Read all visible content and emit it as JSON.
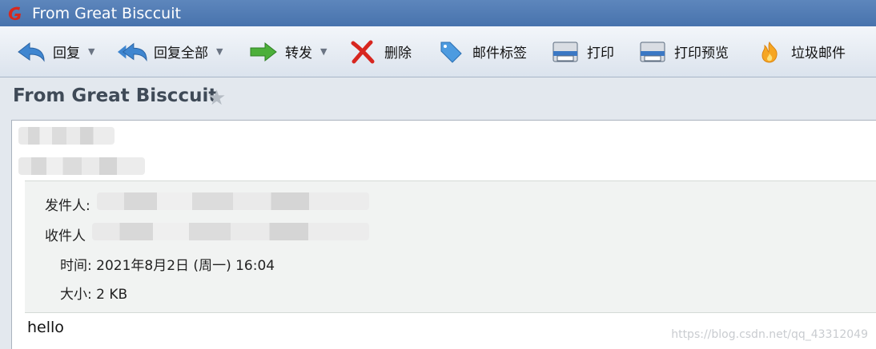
{
  "window": {
    "title": "From Great Bisccuit"
  },
  "toolbar": {
    "items": [
      {
        "label": "回复",
        "icon": "reply-icon",
        "has_dropdown": true
      },
      {
        "label": "回复全部",
        "icon": "reply-all-icon",
        "has_dropdown": true
      },
      {
        "label": "转发",
        "icon": "forward-icon",
        "has_dropdown": true
      },
      {
        "label": "删除",
        "icon": "delete-icon",
        "has_dropdown": false
      },
      {
        "label": "邮件标签",
        "icon": "tag-icon",
        "has_dropdown": false
      },
      {
        "label": "打印",
        "icon": "printer-icon",
        "has_dropdown": false
      },
      {
        "label": "打印预览",
        "icon": "print-preview-icon",
        "has_dropdown": false
      },
      {
        "label": "垃圾邮件",
        "icon": "junk-icon",
        "has_dropdown": false
      }
    ]
  },
  "message": {
    "subject": "From Great Bisccuit",
    "headers": {
      "from_label": "发件人:",
      "to_label": "收件人",
      "time": "时间: 2021年8月2日 (周一) 16:04",
      "size": "大小: 2 KB"
    },
    "body": "hello"
  },
  "watermark": "https://blog.csdn.net/qq_43312049",
  "colors": {
    "titlebar": "#4f79b2",
    "toolbar": "#e6ecf3",
    "subject": "#3f4a57"
  }
}
